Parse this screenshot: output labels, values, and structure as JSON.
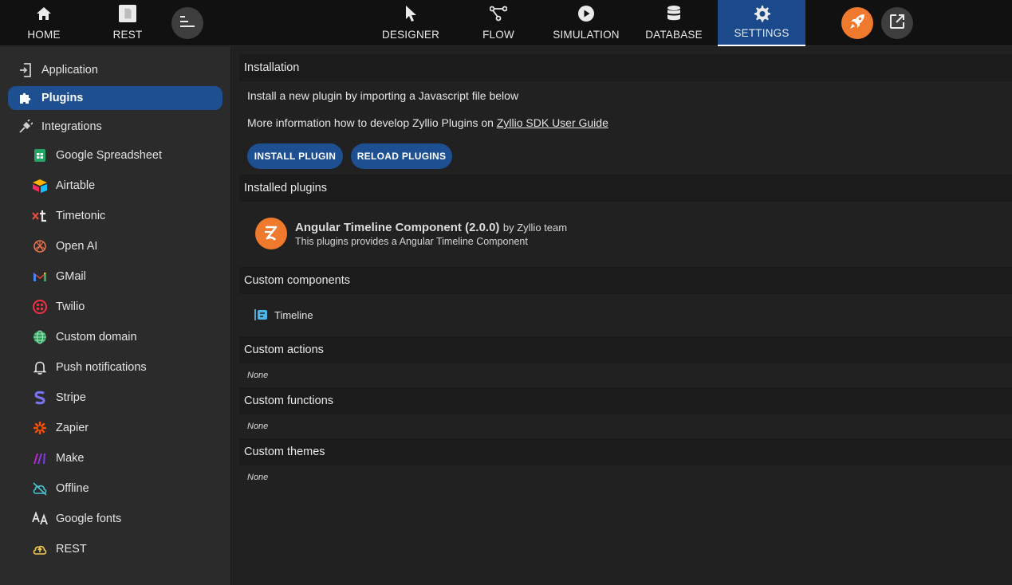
{
  "topbar": {
    "home_label": "HOME",
    "rest_label": "REST",
    "designer_label": "DESIGNER",
    "flow_label": "FLOW",
    "simulation_label": "SIMULATION",
    "database_label": "DATABASE",
    "settings_label": "SETTINGS",
    "active_tab": "SETTINGS"
  },
  "sidebar": {
    "application": "Application",
    "plugins": "Plugins",
    "integrations": "Integrations",
    "items": [
      {
        "label": "Google Spreadsheet",
        "icon": "google-spreadsheet-icon"
      },
      {
        "label": "Airtable",
        "icon": "airtable-icon"
      },
      {
        "label": "Timetonic",
        "icon": "timetonic-icon"
      },
      {
        "label": "Open AI",
        "icon": "openai-icon"
      },
      {
        "label": "GMail",
        "icon": "gmail-icon"
      },
      {
        "label": "Twilio",
        "icon": "twilio-icon"
      },
      {
        "label": "Custom domain",
        "icon": "globe-icon"
      },
      {
        "label": "Push notifications",
        "icon": "bell-icon"
      },
      {
        "label": "Stripe",
        "icon": "stripe-icon"
      },
      {
        "label": "Zapier",
        "icon": "zapier-icon"
      },
      {
        "label": "Make",
        "icon": "make-icon"
      },
      {
        "label": "Offline",
        "icon": "cloud-off-icon"
      },
      {
        "label": "Google fonts",
        "icon": "font-icon"
      },
      {
        "label": "REST",
        "icon": "cloud-upload-icon"
      }
    ]
  },
  "main": {
    "installation_header": "Installation",
    "install_text": "Install a new plugin by importing a Javascript file below",
    "more_info_text": "More information how to develop Zyllio Plugins on ",
    "sdk_link": "Zyllio SDK User Guide",
    "install_button": "INSTALL PLUGIN",
    "reload_button": "RELOAD PLUGINS",
    "installed_header": "Installed plugins",
    "plugin": {
      "name": "Angular Timeline Component (2.0.0)",
      "by": "by Zyllio team",
      "description": "This plugins provides a Angular Timeline Component"
    },
    "components_header": "Custom components",
    "component_name": "Timeline",
    "actions_header": "Custom actions",
    "actions_value": "None",
    "functions_header": "Custom functions",
    "functions_value": "None",
    "themes_header": "Custom themes",
    "themes_value": "None"
  },
  "colors": {
    "accent": "#1d4f91",
    "orange": "#ef7a2e",
    "topbar_bg": "#111111",
    "sidebar_bg": "#2b2b2b",
    "content_bg": "#212121"
  }
}
